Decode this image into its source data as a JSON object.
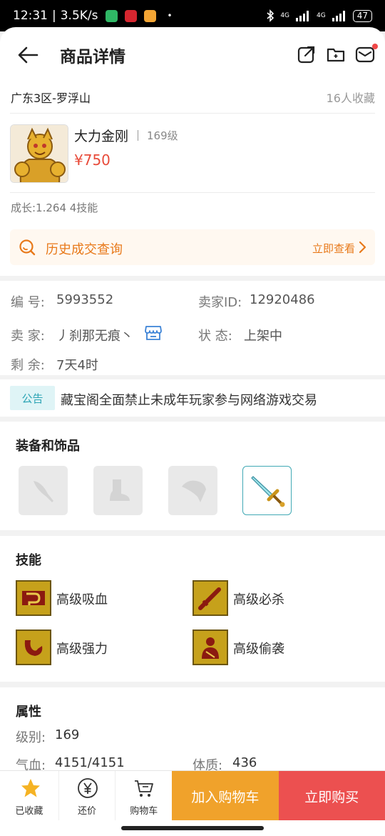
{
  "status_bar": {
    "time": "12:31",
    "speed": "3.5K/s",
    "separator": "|",
    "dot": "•",
    "network": "4G",
    "battery": "47"
  },
  "header": {
    "title": "商品详情",
    "back_icon": "arrow-left-icon",
    "share_icon": "share-icon",
    "folder_icon": "folder-icon",
    "message_icon": "mail-icon"
  },
  "product": {
    "server": "广东3区-罗浮山",
    "favorites": "16人收藏",
    "name": "大力金刚",
    "level": "169级",
    "price": "¥750",
    "growth": "成长:1.264 4技能",
    "history_label": "历史成交查询",
    "history_link": "立即查看"
  },
  "info": {
    "id_label": "编  号:",
    "id_value": "5993552",
    "seller_id_label": "卖家ID:",
    "seller_id_value": "12920486",
    "seller_label": "卖  家:",
    "seller_value": "丿刹那无痕丶",
    "status_label": "状  态:",
    "status_value": "上架中",
    "remain_label": "剩  余:",
    "remain_value": "7天4时"
  },
  "notice": {
    "tag": "公告",
    "text": "藏宝阁全面禁止未成年玩家参与网络游戏交易"
  },
  "equipment": {
    "title": "装备和饰品",
    "slots": [
      "weapon-slot-icon",
      "boots-slot-icon",
      "armor-slot-icon",
      "sword-icon"
    ]
  },
  "skills": {
    "title": "技能",
    "items": [
      {
        "label": "高级吸血",
        "icon": "lifesteal-skill-icon"
      },
      {
        "label": "高级必杀",
        "icon": "critical-skill-icon"
      },
      {
        "label": "高级强力",
        "icon": "strength-skill-icon"
      },
      {
        "label": "高级偷袭",
        "icon": "sneak-attack-skill-icon"
      }
    ]
  },
  "attributes": {
    "title": "属性",
    "level_label": "级别:",
    "level_value": "169",
    "hp_label": "气血:",
    "hp_value": "4151/4151",
    "con_label": "体质:",
    "con_value": "436"
  },
  "bottom_bar": {
    "favorited": "已收藏",
    "bargain": "还价",
    "cart": "购物车",
    "add_to_cart": "加入购物车",
    "buy_now": "立即购买"
  },
  "colors": {
    "accent_orange": "#f0a22b",
    "buy_red": "#ec5050",
    "price_red": "#e84b3a",
    "history_orange": "#e8791a",
    "notice_teal": "#2ba4b4"
  }
}
